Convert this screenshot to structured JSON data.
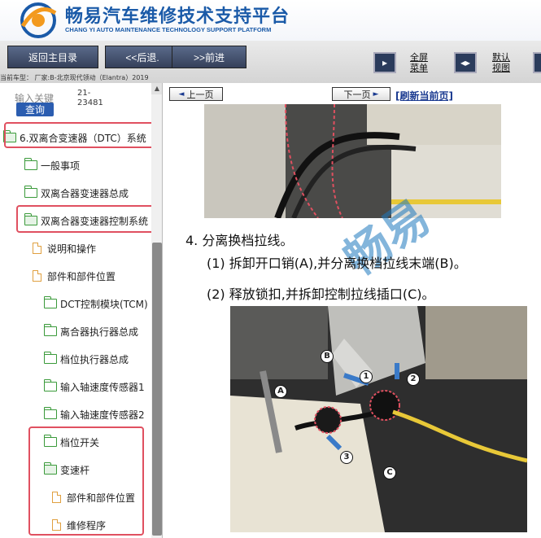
{
  "header": {
    "title": "畅易汽车维修技术支持平台",
    "subtitle": "CHANG YI AUTO MAINTENANCE TECHNOLOGY SUPPORT PLATFORM",
    "brand_color": "#1a5aa8"
  },
  "toolbar": {
    "back_main_label": "返回主目录",
    "back_label": "<<后退.",
    "forward_label": ">>前进",
    "fullscreen_label_line1": "全屏",
    "fullscreen_label_line2": "菜单",
    "default_view_label_line1": "默认",
    "default_view_label_line2": "视图",
    "vehicle_info": "当前车型：  厂家:B-北京现代领动（Elantra）2019"
  },
  "sidebar": {
    "search_placeholder": "输入关键",
    "search_number": "21-23481",
    "search_button": "查询",
    "items": [
      {
        "label": "6.双离合变速器（DTC）系统",
        "type": "folder-open"
      },
      {
        "label": "一般事项",
        "type": "folder"
      },
      {
        "label": "双离合器变速器总成",
        "type": "folder"
      },
      {
        "label": "双离合器变速器控制系统",
        "type": "folder-open"
      },
      {
        "label": "说明和操作",
        "type": "page"
      },
      {
        "label": "部件和部件位置",
        "type": "page"
      },
      {
        "label": "DCT控制模块(TCM)",
        "type": "folder"
      },
      {
        "label": "离合器执行器总成",
        "type": "folder"
      },
      {
        "label": "档位执行器总成",
        "type": "folder"
      },
      {
        "label": "输入轴速度传感器1",
        "type": "folder"
      },
      {
        "label": "输入轴速度传感器2",
        "type": "folder"
      },
      {
        "label": "档位开关",
        "type": "folder"
      },
      {
        "label": "变速杆",
        "type": "folder-open"
      },
      {
        "label": "部件和部件位置",
        "type": "page"
      },
      {
        "label": "维修程序",
        "type": "page"
      }
    ]
  },
  "main_nav": {
    "prev_label": "上一页",
    "next_label": "下一页",
    "refresh_label": "[刷新当前页]"
  },
  "content": {
    "step_title": "4.  分离换档拉线。",
    "step_sub1": "(1)  拆卸开口销(A),并分离换档拉线末端(B)。",
    "step_sub2": "(2)  释放锁扣,并拆卸控制拉线插口(C)。",
    "watermark": "畅易",
    "callouts": [
      "A",
      "B",
      "C",
      "1",
      "2",
      "3"
    ]
  }
}
